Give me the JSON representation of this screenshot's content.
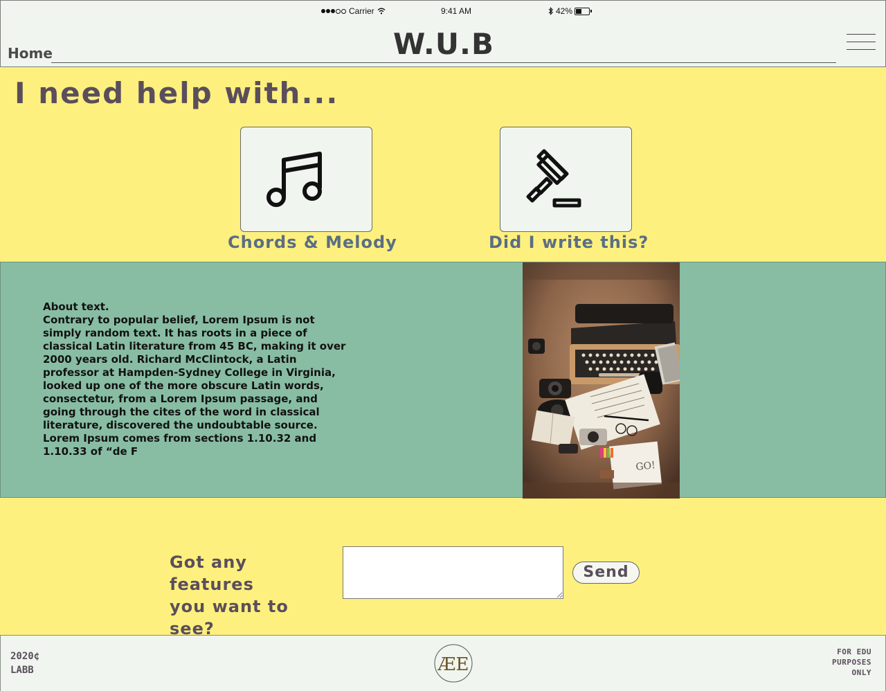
{
  "status_bar": {
    "carrier": "Carrier",
    "time": "9:41 AM",
    "battery": "42%",
    "battery_level": 0.42,
    "signal_bars_filled": 3,
    "signal_bars_total": 5
  },
  "header": {
    "brand": "W.U.B",
    "home_label": "Home",
    "menu_icon": "hamburger-menu-icon"
  },
  "help": {
    "title": "I need help with...",
    "cards": [
      {
        "label": "Chords & Melody",
        "icon": "music-note-icon"
      },
      {
        "label": "Did I write this?",
        "icon": "gavel-icon"
      }
    ]
  },
  "about": {
    "heading": "About text.",
    "body": "Contrary to popular belief, Lorem Ipsum is not simply random text. It has roots in a piece of classical Latin literature from 45 BC, making it over 2000 years old. Richard McClintock, a Latin professor at Hampden-Sydney College in Virginia, looked up one of the more obscure Latin words, consectetur, from a Lorem Ipsum passage, and going through the cites of the word in classical literature, discovered the undoubtable source. Lorem Ipsum comes from sections 1.10.32 and 1.10.33 of “de F"
  },
  "feedback": {
    "label_line1": "Got any features",
    "label_line2": "you want to see?",
    "input_value": "",
    "send_label": "Send"
  },
  "footer": {
    "left_line1": "2020¢",
    "left_line2": "LABB",
    "right_line1": "FOR EDU",
    "right_line2": "PURPOSES",
    "right_line3": "ONLY",
    "logo_text": "ÆE"
  },
  "colors": {
    "page_bg": "#fef07e",
    "header_bg": "#f0f5ef",
    "about_bg": "#88bda4",
    "title_text": "#5a4e5c",
    "card_label": "#5a6e84"
  }
}
